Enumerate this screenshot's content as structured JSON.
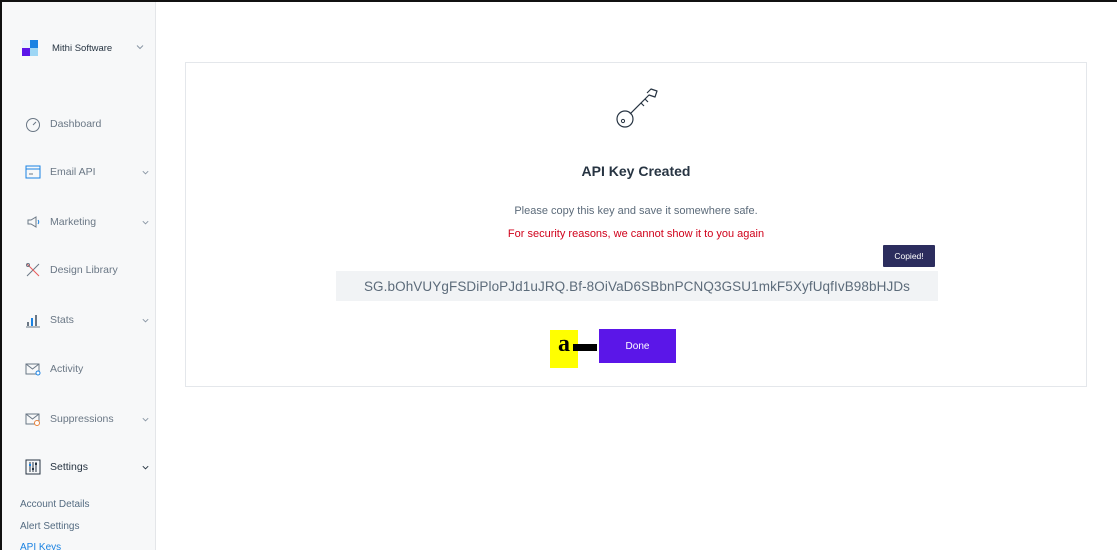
{
  "sidebar": {
    "brand_name": "Mithi Software",
    "items": [
      {
        "label": "Dashboard",
        "icon": "speedometer-icon"
      },
      {
        "label": "Email API",
        "icon": "email-window-icon"
      },
      {
        "label": "Marketing",
        "icon": "megaphone-icon"
      },
      {
        "label": "Design Library",
        "icon": "design-tools-icon"
      },
      {
        "label": "Stats",
        "icon": "bar-stats-icon"
      },
      {
        "label": "Activity",
        "icon": "activity-envelope-icon"
      },
      {
        "label": "Suppressions",
        "icon": "suppression-envelope-icon"
      },
      {
        "label": "Settings",
        "icon": "settings-sliders-icon"
      }
    ],
    "sub_links": [
      "Account Details",
      "Alert Settings",
      "API Keys"
    ]
  },
  "card": {
    "title": "API Key Created",
    "subtitle": "Please copy this key and save it somewhere safe.",
    "warning": "For security reasons, we cannot show it to you again",
    "copied_label": "Copied!",
    "api_key": "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",
    "done_label": "Done"
  },
  "annotation": {
    "label": "a"
  },
  "colors": {
    "accent_button": "#5b16e8",
    "copied_tooltip": "#2c2d5e",
    "warning_text": "#d0021b",
    "annotation_bg": "#ffff00"
  }
}
